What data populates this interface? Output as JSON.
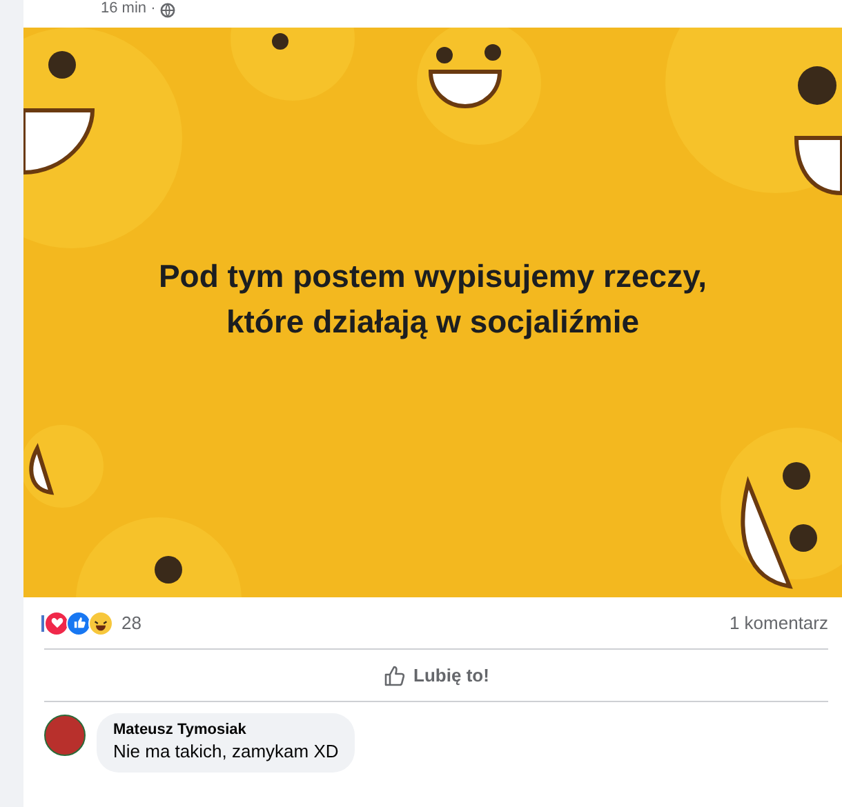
{
  "post": {
    "time": "16 min ·",
    "image_text": "Pod tym postem wypisujemy rzeczy, które działają w socjaliźmie",
    "reaction_count": "28",
    "comment_count": "1 komentarz",
    "like_label": "Lubię to!"
  },
  "comments": [
    {
      "author": "Mateusz Tymosiak",
      "text": "Nie ma takich, zamykam XD"
    }
  ]
}
